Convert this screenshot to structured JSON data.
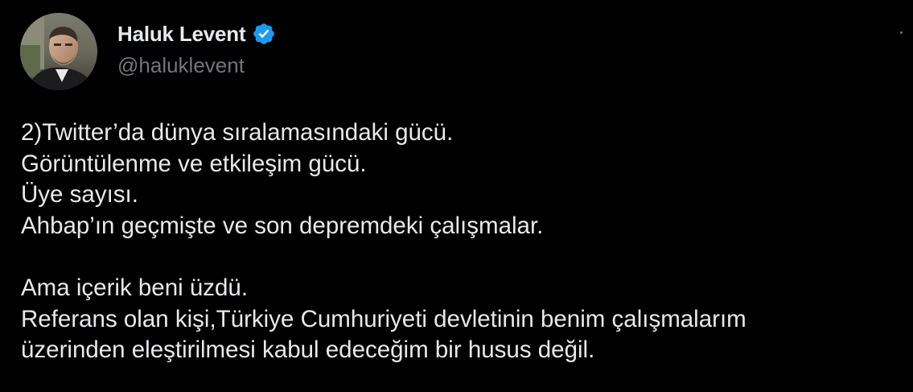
{
  "author": {
    "display_name": "Haluk Levent",
    "handle": "@haluklevent",
    "verified": true
  },
  "icons": {
    "verified": "verified-badge-icon",
    "more": "more-options-icon"
  },
  "colors": {
    "background": "#000000",
    "text_primary": "#e7e9ea",
    "text_secondary": "#71767b",
    "verified_blue": "#1d9bf0"
  },
  "tweet": {
    "paragraph_1": [
      "2)Twitter’da dünya sıralamasındaki gücü.",
      "Görüntülenme ve etkileşim gücü.",
      "Üye sayısı.",
      "Ahbap’ın geçmişte ve son depremdeki çalışmalar."
    ],
    "paragraph_2": [
      "Ama içerik beni üzdü.",
      "Referans olan kişi,Türkiye Cumhuriyeti devletinin benim çalışmalarım",
      "üzerinden eleştirilmesi kabul edeceğim bir husus değil."
    ]
  }
}
